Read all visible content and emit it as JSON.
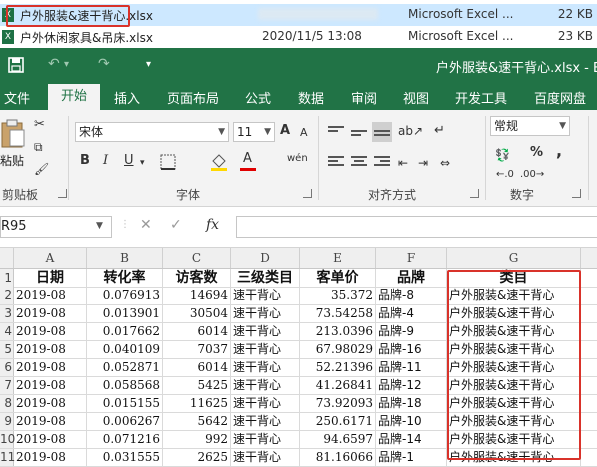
{
  "explorer": {
    "files": [
      {
        "name": "户外服装&速干背心.xlsx",
        "date": "",
        "type": "Microsoft Excel ...",
        "size": "22 KB"
      },
      {
        "name": "户外休闲家具&吊床.xlsx",
        "date": "2020/11/5 13:08",
        "type": "Microsoft Excel ...",
        "size": "23 KB"
      }
    ],
    "file_icon": "X"
  },
  "titlebar": {
    "title": "户外服装&速干背心.xlsx - Exc",
    "undo_glyph": "↶",
    "redo_glyph": "↷",
    "dropdown_glyph": "▾"
  },
  "tabs": [
    "文件",
    "开始",
    "插入",
    "页面布局",
    "公式",
    "数据",
    "审阅",
    "视图",
    "开发工具",
    "百度网盘"
  ],
  "ribbon": {
    "paste_label": "粘贴",
    "clipboard_label": "剪贴板",
    "font_name": "宋体",
    "font_size": "11",
    "font_group_label": "字体",
    "bold": "B",
    "italic": "I",
    "underline": "U",
    "grow_font": "A",
    "shrink_font": "A",
    "font_color": "A",
    "wen": "wén",
    "align_group_label": "对齐方式",
    "number_format": "常规",
    "number_group_label": "数字",
    "percent": "%",
    "comma": ","
  },
  "formula_bar": {
    "name_box": "R95",
    "cancel": "✕",
    "confirm": "✓",
    "fx": "fx",
    "content": ""
  },
  "grid": {
    "columns": [
      "A",
      "B",
      "C",
      "D",
      "E",
      "F",
      "G"
    ],
    "header_row": {
      "rownum": "1",
      "cells": [
        "日期",
        "转化率",
        "访客数",
        "三级类目",
        "客单价",
        "品牌",
        "类目"
      ]
    },
    "rows": [
      {
        "rownum": "2",
        "cells": [
          "2019-08",
          "0.076913",
          "14694",
          "速干背心",
          "35.372",
          "品牌-8",
          "户外服装&速干背心"
        ]
      },
      {
        "rownum": "3",
        "cells": [
          "2019-08",
          "0.013901",
          "30504",
          "速干背心",
          "73.54258",
          "品牌-4",
          "户外服装&速干背心"
        ]
      },
      {
        "rownum": "4",
        "cells": [
          "2019-08",
          "0.017662",
          "6014",
          "速干背心",
          "213.0396",
          "品牌-9",
          "户外服装&速干背心"
        ]
      },
      {
        "rownum": "5",
        "cells": [
          "2019-08",
          "0.040109",
          "7037",
          "速干背心",
          "67.98029",
          "品牌-16",
          "户外服装&速干背心"
        ]
      },
      {
        "rownum": "6",
        "cells": [
          "2019-08",
          "0.052871",
          "6014",
          "速干背心",
          "52.21396",
          "品牌-11",
          "户外服装&速干背心"
        ]
      },
      {
        "rownum": "7",
        "cells": [
          "2019-08",
          "0.058568",
          "5425",
          "速干背心",
          "41.26841",
          "品牌-12",
          "户外服装&速干背心"
        ]
      },
      {
        "rownum": "8",
        "cells": [
          "2019-08",
          "0.015155",
          "11625",
          "速干背心",
          "73.92093",
          "品牌-18",
          "户外服装&速干背心"
        ]
      },
      {
        "rownum": "9",
        "cells": [
          "2019-08",
          "0.006267",
          "5642",
          "速干背心",
          "250.6171",
          "品牌-10",
          "户外服装&速干背心"
        ]
      },
      {
        "rownum": "10",
        "cells": [
          "2019-08",
          "0.071216",
          "992",
          "速干背心",
          "94.6597",
          "品牌-14",
          "户外服装&速干背心"
        ]
      },
      {
        "rownum": "11",
        "cells": [
          "2019-08",
          "0.031555",
          "2625",
          "速干背心",
          "81.16066",
          "品牌-1",
          "户外服装&速干背心"
        ]
      }
    ]
  },
  "colors": {
    "excel_green": "#217346",
    "highlight_red": "#d9322a",
    "selection_blue": "#cde8ff"
  }
}
